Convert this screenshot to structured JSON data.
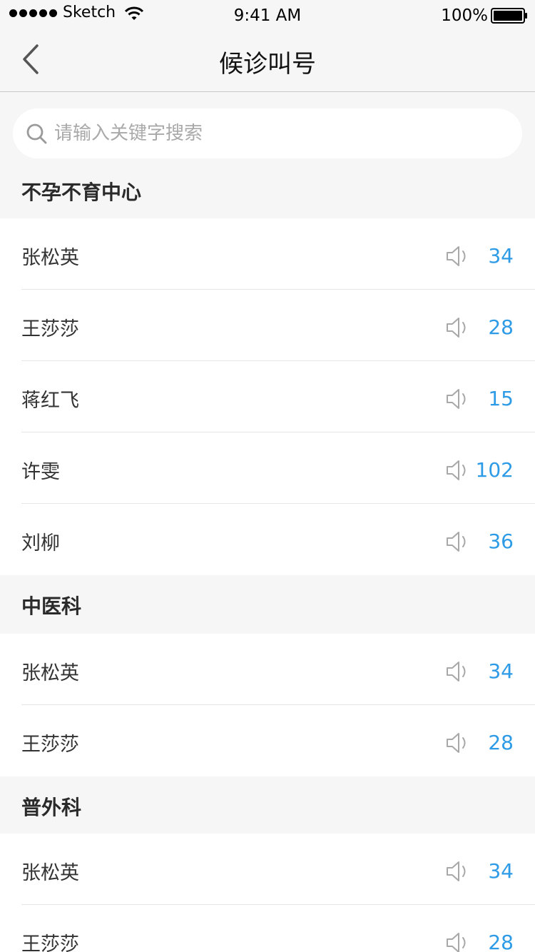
{
  "status_bar": {
    "carrier": "Sketch",
    "time": "9:41 AM",
    "battery": "100%"
  },
  "nav": {
    "title": "候诊叫号"
  },
  "search": {
    "placeholder": "请输入关键字搜索"
  },
  "sections": [
    {
      "title": "不孕不育中心",
      "rows": [
        {
          "name": "张松英",
          "number": "34"
        },
        {
          "name": "王莎莎",
          "number": "28"
        },
        {
          "name": "蒋红飞",
          "number": "15"
        },
        {
          "name": "许雯",
          "number": "102"
        },
        {
          "name": "刘柳",
          "number": "36"
        }
      ]
    },
    {
      "title": "中医科",
      "rows": [
        {
          "name": "张松英",
          "number": "34"
        },
        {
          "name": "王莎莎",
          "number": "28"
        }
      ]
    },
    {
      "title": "普外科",
      "rows": [
        {
          "name": "张松英",
          "number": "34"
        },
        {
          "name": "王莎莎",
          "number": "28"
        }
      ]
    }
  ],
  "colors": {
    "accent": "#2e9be6",
    "background": "#f6f6f6"
  },
  "icons": {
    "back": "chevron-left-icon",
    "search": "search-icon",
    "call": "speaker-icon"
  }
}
